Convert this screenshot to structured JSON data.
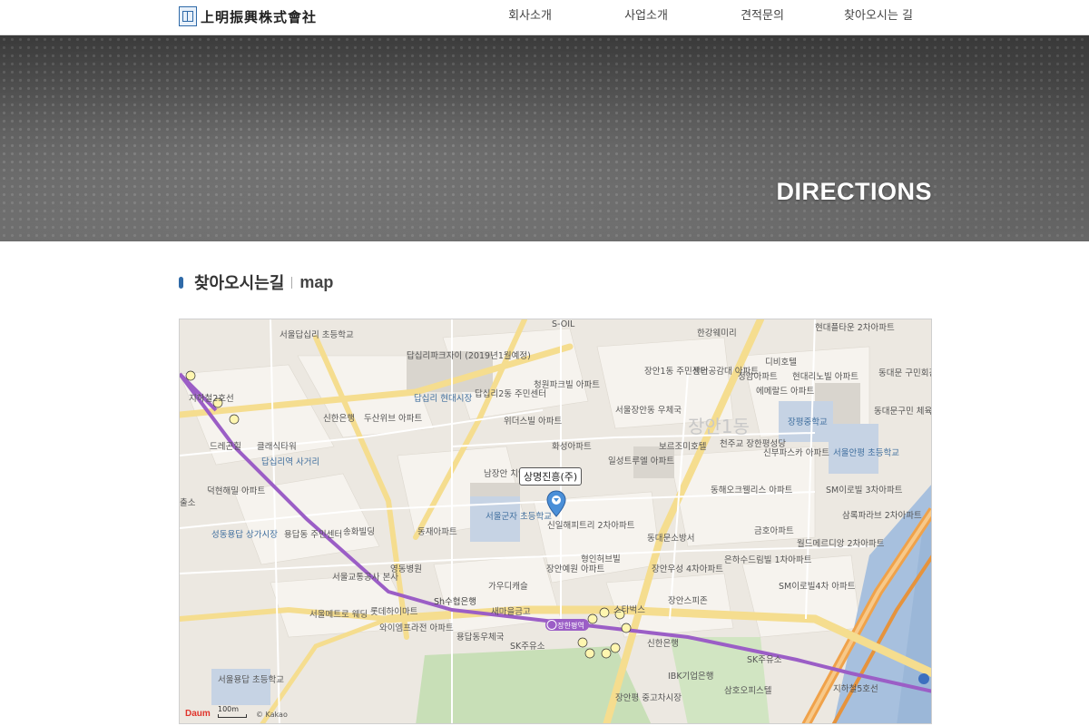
{
  "header": {
    "logo_text": "上明振興株式會社",
    "nav": [
      "회사소개",
      "사업소개",
      "견적문의",
      "찾아오시는 길"
    ]
  },
  "banner": {
    "title": "DIRECTIONS"
  },
  "section": {
    "title_ko": "찾아오시는길",
    "title_en": "map"
  },
  "map": {
    "marker_label": "상명진흥(주)",
    "scale_label": "100m",
    "copyright": "© Kakao",
    "logo": "Daum",
    "district_label": "장안1동",
    "places": {
      "p01": "S-OIL",
      "p02": "한강웨미리",
      "p03": "현대플타운 2차아파트",
      "p04": "서울답십리 초등학교",
      "p05": "답십리파크자이 (2019년1월예정)",
      "p06": "장안1동 주민센터",
      "p07": "장안공감대 아파트",
      "p08": "디비호텔",
      "p09": "청원파크빌 아파트",
      "p10": "답십리2동 주민센터",
      "p11": "답십리 현대시장",
      "p12": "신한은행",
      "p13": "두산위브 아파트",
      "p14": "위더스빌 아파트",
      "p15": "서울장안동 우체국",
      "p16": "정암아파트",
      "p17": "에메랄드 아파트",
      "p18": "현대리노빌 아파트",
      "p19": "동대문 구민회관",
      "p20": "장평중학교",
      "p21": "동대문구민 체육센터",
      "p22": "천주교 장한평성당",
      "p23": "보르조미호텔",
      "p24": "드레곤힐",
      "p25": "클래식타워",
      "p26": "화성아파트",
      "p27": "일성트루엘 아파트",
      "p28": "신부파스카 아파트",
      "p29": "서울안평 초등학교",
      "p30": "답십리역 사거리",
      "p31": "남장안 치안센터",
      "p32": "서울군자 초등학교",
      "p33": "신일해피트리 2차아파트",
      "p34": "동해오크웰리스 아파트",
      "p35": "SM이로빌 3차아파트",
      "p36": "덕현해밀 아파트",
      "p37": "출소",
      "p38": "용답동 주민센터",
      "p39": "송화빌딩",
      "p40": "동재아파트",
      "p41": "동대문소방서",
      "p42": "금호아파트",
      "p43": "삼록파라브 2차아파트",
      "p44": "성동용답 상가시장",
      "p45": "월드메르디앙 2차아파트",
      "p46": "서울교통공사 본사",
      "p47": "영동병원",
      "p48": "형인허브빌",
      "p49": "장안예원 아파트",
      "p50": "장안우성 4차아파트",
      "p51": "은하수드림빌 1차아파트",
      "p52": "가우디캐슬",
      "p53": "SM이로빌4차 아파트",
      "p54": "Sh수협은행",
      "p55": "장안스피존",
      "p56": "서울메트로 웨딩",
      "p57": "롯데하이마트",
      "p58": "새마을금고",
      "p59": "스타벅스",
      "p60": "와이엠프라전 아파트",
      "p61": "장한평역",
      "p62": "용답동우체국",
      "p63": "SK주유소",
      "p64": "신한은행",
      "p65": "SK주유소",
      "p66": "서울용답 초등학교",
      "p67": "IBK기업은행",
      "p68": "장안평 중고차시장",
      "p69": "삼호오피스텔",
      "p70": "지하철5호선",
      "p71": "지하철2호선"
    }
  }
}
